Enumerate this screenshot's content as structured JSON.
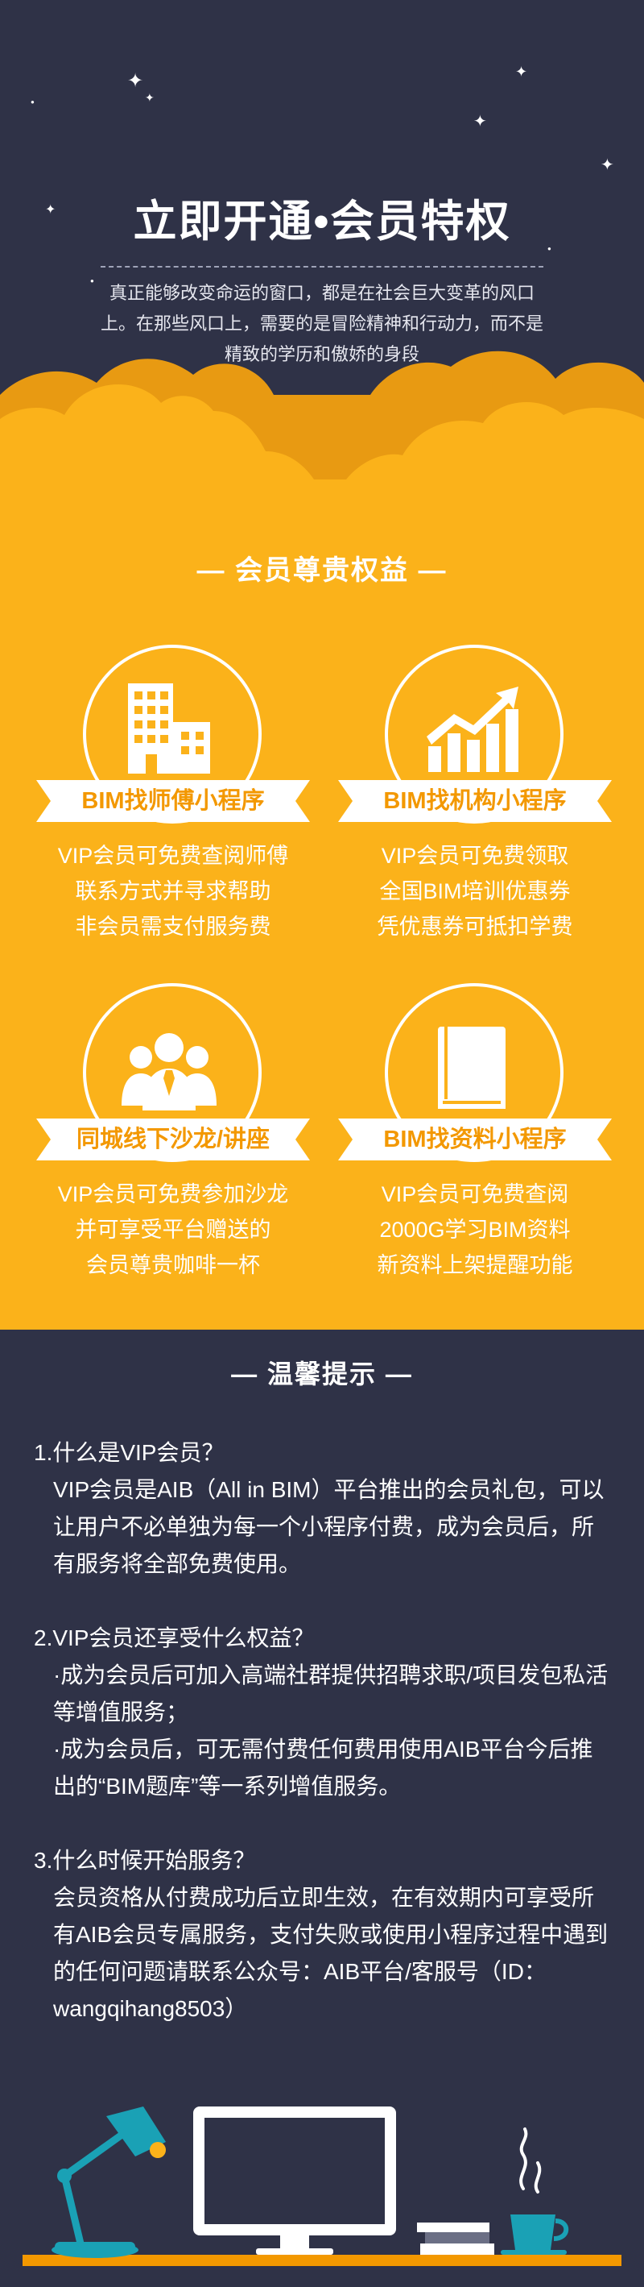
{
  "hero": {
    "title": "立即开通•会员特权",
    "intro": "真正能够改变命运的窗口，都是在社会巨大变革的风口上。在那些风口上，需要的是冒险精神和行动力，而不是精致的学历和傲娇的身段"
  },
  "rights": {
    "heading": "— 会员尊贵权益 —",
    "cards": [
      {
        "icon": "building-icon",
        "title": "BIM找师傅小程序",
        "lines": [
          "VIP会员可免费查阅师傅",
          "联系方式并寻求帮助",
          "非会员需支付服务费"
        ]
      },
      {
        "icon": "growth-chart-icon",
        "title": "BIM找机构小程序",
        "lines": [
          "VIP会员可免费领取",
          "全国BIM培训优惠券",
          "凭优惠券可抵扣学费"
        ]
      },
      {
        "icon": "people-group-icon",
        "title": "同城线下沙龙/讲座",
        "lines": [
          "VIP会员可免费参加沙龙",
          "并可享受平台赠送的",
          "会员尊贵咖啡一杯"
        ]
      },
      {
        "icon": "book-icon",
        "title": "BIM找资料小程序",
        "lines": [
          "VIP会员可免费查阅",
          "2000G学习BIM资料",
          "新资料上架提醒功能"
        ]
      }
    ]
  },
  "tips": {
    "heading": "—  温馨提示  —",
    "items": [
      {
        "question": "1.什么是VIP会员？",
        "answers": [
          "VIP会员是AIB（All in BIM）平台推出的会员礼包，可以让用户不必单独为每一个小程序付费，成为会员后，所有服务将全部免费使用。"
        ]
      },
      {
        "question": "2.VIP会员还享受什么权益？",
        "answers": [
          "·成为会员后可加入高端社群提供招聘求职/项目发包私活等增值服务；",
          "·成为会员后，可无需付费任何费用使用AIB平台今后推出的“BIM题库”等一系列增值服务。"
        ]
      },
      {
        "question": "3.什么时候开始服务？",
        "answers": [
          "会员资格从付费成功后立即生效，在有效期内可享受所有AIB会员专属服务，支付失败或使用小程序过程中遇到的任何问题请联系公众号：AIB平台/客服号（ID：wangqihang8503）"
        ]
      }
    ]
  },
  "colors": {
    "navy": "#2f3247",
    "yellow": "#fbb21a",
    "orange": "#f39800",
    "teal": "#1aa1b5"
  }
}
